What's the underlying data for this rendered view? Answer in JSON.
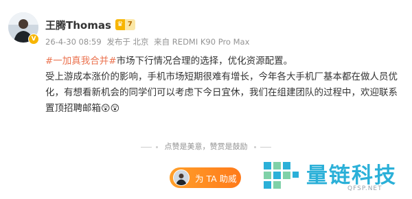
{
  "post": {
    "author": {
      "name": "王腾Thomas",
      "verified_badge": "V",
      "fan_badge_level": "7",
      "fan_badge_color": "#f7b500"
    },
    "meta": {
      "time": "26-4-30 08:59",
      "location": "发布于 北京",
      "device": "来自 REDMI K90 Pro Max"
    },
    "content": {
      "topic": "#一加真我合并#",
      "line1_rest": "市场下行情况合理的选择，优化资源配置。",
      "paragraph2": "受上游成本涨价的影响，手机市场短期很难有增长，今年各大手机厂基本都在做人员优化，有想看新机会的同学们可以考虑下今日宜休，我们在组建团队的过程中，欢迎联系置顶招聘邮箱",
      "emojis": [
        "😲",
        "😲"
      ]
    },
    "like_hint": "点赞是美意，赞赏是鼓励",
    "assist_button": {
      "label": "为 TA 助威"
    }
  },
  "watermark": {
    "text": "量链科技",
    "url": "QFSP.NET",
    "color": "#2bb0d8"
  },
  "colors": {
    "topic": "#eb7350",
    "meta": "#939393",
    "button": "#ff8a1f"
  }
}
